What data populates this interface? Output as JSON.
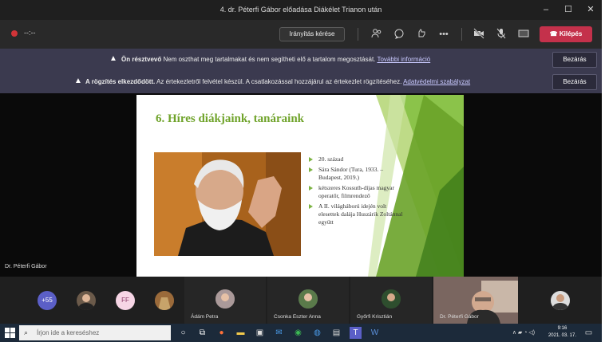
{
  "window": {
    "title": "4. dr. Péterfi Gábor előadása Diákélet Trianon után",
    "minimize": "–",
    "maximize": "☐",
    "close": "✕"
  },
  "toolbar": {
    "timer": "--:--",
    "request_control": "Irányítás kérése",
    "leave": "Kilépés",
    "icons": [
      "people-icon",
      "chat-icon",
      "reactions-icon",
      "more-icon",
      "camera-off-icon",
      "mic-off-icon",
      "share-icon"
    ]
  },
  "banners": [
    {
      "bold": "Ön résztvevő",
      "text": "Nem oszthat meg tartalmakat és nem segítheti elő a tartalom megosztását.",
      "link": "További információ",
      "close": "Bezárás"
    },
    {
      "bold": "A rögzítés elkezdődött.",
      "text": "Az értekezletről felvétel készül. A csatlakozással hozzájárul az értekezlet rögzítéséhez.",
      "link": "Adatvédelmi szabályzat",
      "close": "Bezárás"
    }
  ],
  "slide": {
    "title": "6. Híres diákjaink, tanáraink",
    "bullets": [
      "20. század",
      "Sára Sándor (Tura, 1933. – Budapest, 2019.)",
      "kétszeres Kossuth-díjas magyar operatőr, filmrendező",
      "A II. világháború idején volt elesettek dalája Huszárik Zoltánnal együtt"
    ],
    "accent": "#7cb342"
  },
  "presenter": "Dr. Péterfi Gábor",
  "participants": {
    "overflow": "+55",
    "initials": "FF",
    "named": [
      "Ádám Petra",
      "Csonka Eszter Anna",
      "Győrfi Krisztián",
      "Dr. Péterfi Gábor"
    ]
  },
  "taskbar": {
    "search_placeholder": "Írjon ide a kereséshez",
    "time": "9:16",
    "date": "2021. 03. 17."
  }
}
